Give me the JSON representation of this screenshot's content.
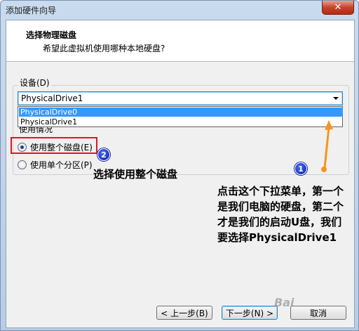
{
  "window": {
    "title": "添加硬件向导",
    "close_label": "✕"
  },
  "header": {
    "title": "选择物理磁盘",
    "subtitle": "希望此虚拟机使用哪种本地硬盘?"
  },
  "device": {
    "label": "设备(D)",
    "selected": "PhysicalDrive1",
    "options": [
      "PhysicalDrive0",
      "PhysicalDrive1"
    ]
  },
  "usage": {
    "label": "使用情况",
    "options": [
      {
        "label": "使用整个磁盘(E)",
        "checked": true
      },
      {
        "label": "使用单个分区(P)",
        "checked": false
      }
    ]
  },
  "annotations": {
    "badge1": "1",
    "badge2": "2",
    "note_short": "选择使用整个磁盘",
    "note_long": "点击这个下拉菜单，第一个是我们电脑的硬盘，第二个才是我们的启动U盘，我们要选择PhysicalDrive1",
    "arrow_color": "#f7941d",
    "highlight_color": "#e0171f"
  },
  "buttons": {
    "back": "< 上一步(B)",
    "next": "下一步(N) >",
    "cancel": "取消"
  },
  "watermark": "Bai"
}
